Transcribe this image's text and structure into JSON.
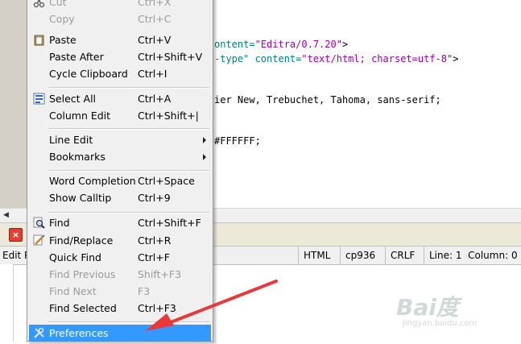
{
  "editor": {
    "lines": [
      {
        "parts": [
          {
            "c": "c-attr",
            "t": "ontent="
          },
          {
            "c": "c-str",
            "t": "\"Editra/0.7.20\""
          },
          {
            "c": "c-txt",
            "t": ">"
          }
        ]
      },
      {
        "parts": [
          {
            "c": "c-attr",
            "t": "-type\" content="
          },
          {
            "c": "c-str",
            "t": "\"text/html; charset=utf-8\""
          },
          {
            "c": "c-txt",
            "t": ">"
          }
        ]
      },
      {
        "parts": [
          {
            "c": "c-txt",
            "t": "ier New, Trebuchet, Tahoma, sans-serif;"
          }
        ]
      },
      {
        "parts": [
          {
            "c": "c-txt",
            "t": "#FFFFFF;"
          }
        ]
      }
    ]
  },
  "menu": {
    "items": [
      {
        "label": "Cut",
        "shortcut": "Ctrl+X",
        "disabled": true,
        "icon": "scissors-icon"
      },
      {
        "label": "Copy",
        "shortcut": "Ctrl+C",
        "disabled": true
      },
      {
        "label": "Paste",
        "shortcut": "Ctrl+V",
        "icon": "clipboard-icon"
      },
      {
        "label": "Paste After",
        "shortcut": "Ctrl+Shift+V"
      },
      {
        "label": "Cycle Clipboard",
        "shortcut": "Ctrl+I"
      },
      {
        "label": "Select All",
        "shortcut": "Ctrl+A",
        "icon": "select-all-icon"
      },
      {
        "label": "Column Edit",
        "shortcut": "Ctrl+Shift+|"
      },
      {
        "label": "Line Edit",
        "submenu": true
      },
      {
        "label": "Bookmarks",
        "submenu": true
      },
      {
        "label": "Word Completion",
        "shortcut": "Ctrl+Space"
      },
      {
        "label": "Show Calltip",
        "shortcut": "Ctrl+9"
      },
      {
        "label": "Find",
        "shortcut": "Ctrl+Shift+F",
        "icon": "find-icon"
      },
      {
        "label": "Find/Replace",
        "shortcut": "Ctrl+R",
        "icon": "find-replace-icon"
      },
      {
        "label": "Quick Find",
        "shortcut": "Ctrl+F"
      },
      {
        "label": "Find Previous",
        "shortcut": "Shift+F3",
        "disabled": true
      },
      {
        "label": "Find Next",
        "shortcut": "F3",
        "disabled": true
      },
      {
        "label": "Find Selected",
        "shortcut": "Ctrl+F3"
      },
      {
        "label": "Preferences",
        "highlighted": true,
        "icon": "preferences-icon"
      }
    ]
  },
  "statusbar": {
    "left": "Edit P",
    "lang": "HTML",
    "encoding": "cp936",
    "eol": "CRLF",
    "position": "Line: 1  Column: 0"
  },
  "watermark": {
    "text": "Bai度",
    "sub": "jingyan.baidu.com"
  },
  "colors": {
    "highlight": "#3399ff",
    "arrow": "#e83a3a"
  }
}
